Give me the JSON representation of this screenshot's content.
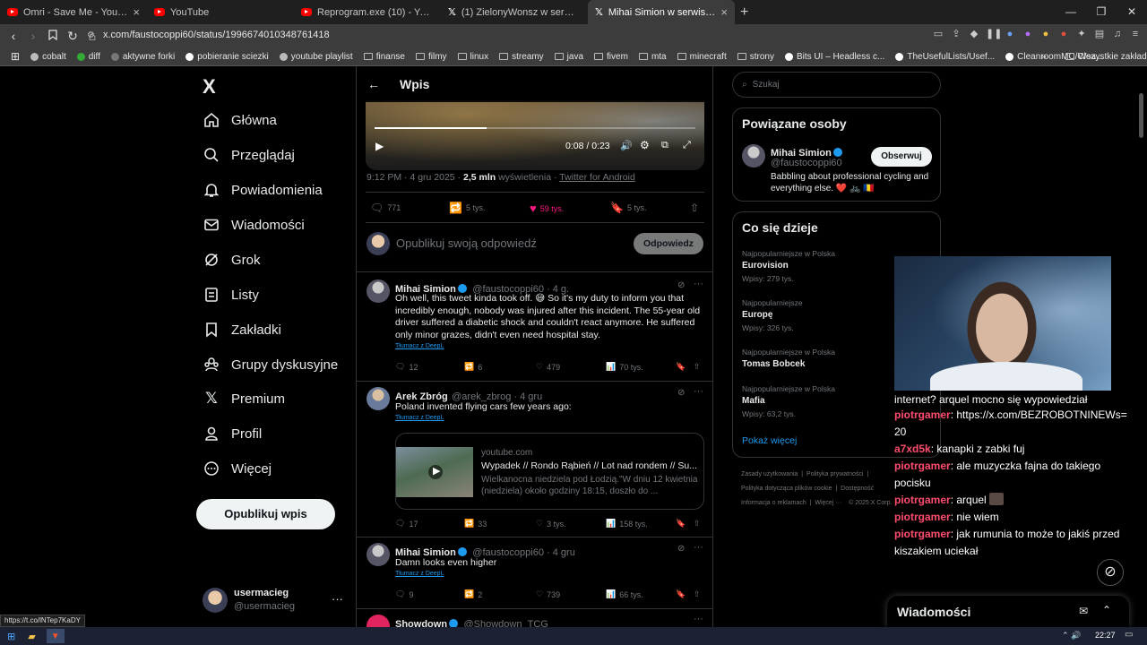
{
  "browser": {
    "tabs": [
      {
        "title": "Omri - Save Me - YouTube",
        "icon": "youtube-icon"
      },
      {
        "title": "YouTube",
        "icon": "youtube-icon"
      },
      {
        "title": "Reprogram.exe (10) - YouTube",
        "icon": "youtube-icon"
      },
      {
        "title": "(1) ZielonyWonsz w serwisie X: „Daw",
        "icon": "x-icon"
      },
      {
        "title": "Mihai Simion w serwisie X: „The",
        "icon": "x-icon",
        "active": true
      }
    ],
    "url": "x.com/faustocoppi60/status/1996674010348761418",
    "bookmarks": [
      "cobalt",
      "diff",
      "aktywne forki",
      "pobieranie sciezki",
      "youtube playlist",
      "finanse",
      "filmy",
      "linux",
      "streamy",
      "java",
      "fivem",
      "mta",
      "minecraft",
      "strony",
      "Bits UI – Headless c...",
      "TheUsefulLists/Usef...",
      "CleanroomMC/Clea..."
    ],
    "bookmarks_other": "Wszystkie zakładki",
    "status_url": "https://t.co/lNTep7KaDY"
  },
  "sidebar": {
    "logo": "X",
    "items": [
      {
        "label": "Główna",
        "icon": "home-icon"
      },
      {
        "label": "Przeglądaj",
        "icon": "search-icon"
      },
      {
        "label": "Powiadomienia",
        "icon": "bell-icon"
      },
      {
        "label": "Wiadomości",
        "icon": "mail-icon"
      },
      {
        "label": "Grok",
        "icon": "grok-icon"
      },
      {
        "label": "Listy",
        "icon": "list-icon"
      },
      {
        "label": "Zakładki",
        "icon": "bookmark-icon"
      },
      {
        "label": "Grupy dyskusyjne",
        "icon": "communities-icon"
      },
      {
        "label": "Premium",
        "icon": "x-premium-icon"
      },
      {
        "label": "Profil",
        "icon": "profile-icon"
      },
      {
        "label": "Więcej",
        "icon": "more-icon"
      }
    ],
    "publish_label": "Opublikuj wpis",
    "user": {
      "name": "usermacieg",
      "handle": "@usermacieg"
    }
  },
  "main": {
    "header_title": "Wpis",
    "video": {
      "time": "0:08 / 0:23",
      "progress": 0.35
    },
    "post_meta": {
      "time": "9:12 PM · 4 gru 2025 ·",
      "views_count": "2,5 mln",
      "views_label": "wyświetlenia ·",
      "source": "Twitter for Android"
    },
    "post_actions": {
      "replies": "771",
      "reposts": "5 tys.",
      "likes": "59 tys.",
      "bookmarks": "5 tys."
    },
    "reply": {
      "placeholder": "Opublikuj swoją odpowiedź",
      "button": "Odpowiedz"
    },
    "replies": [
      {
        "name": "Mihai Simion",
        "handle": "@faustocoppi60 · 4 g.",
        "text": "Oh well, this tweet kinda took off. 😅 So it's my duty to inform you that incredibly enough, nobody was injured after this incident. The 55-year old driver suffered a diabetic shock and couldn't react anymore. He suffered only minor grazes, didn't even need hospital stay.",
        "translate": "Tłumacz z DeepL",
        "stats": {
          "replies": "12",
          "reposts": "6",
          "likes": "479",
          "views": "70 tys."
        }
      },
      {
        "name": "Arek Zbróg",
        "handle": "@arek_zbrog · 4 gru",
        "text": "Poland invented flying cars few years ago:",
        "translate": "Tłumacz z DeepL",
        "card": {
          "domain": "youtube.com",
          "title": "Wypadek // Rondo Rąbień // Lot nad rondem // Su...",
          "desc": "Wielkanocna niedziela pod Łodzią.\"W dniu 12 kwietnia (niedziela) około godziny 18:15, doszło do ..."
        },
        "stats": {
          "replies": "17",
          "reposts": "33",
          "likes": "3 tys.",
          "views": "158 tys."
        }
      },
      {
        "name": "Mihai Simion",
        "handle": "@faustocoppi60 · 4 gru",
        "text": "Damn looks even higher",
        "translate": "Tłumacz z DeepL",
        "stats": {
          "replies": "9",
          "reposts": "2",
          "likes": "739",
          "views": "66 tys."
        }
      },
      {
        "name": "Showdown",
        "handle": "@Showdown_TCG"
      }
    ]
  },
  "right": {
    "search_placeholder": "Szukaj",
    "related_title": "Powiązane osoby",
    "related_person": {
      "name": "Mihai Simion",
      "handle": "@faustocoppi60",
      "bio": "Babbling about professional cycling and everything else. ❤️ 🚲 🇷🇴",
      "follow": "Obserwuj"
    },
    "trends_title": "Co się dzieje",
    "trends": [
      {
        "context": "Najpopularniejsze w Polska",
        "name": "Eurovision",
        "count": "Wpisy: 279 tys."
      },
      {
        "context": "Najpopularniejsze",
        "name": "Europę",
        "count": "Wpisy: 326 tys."
      },
      {
        "context": "Najpopularniejsze w Polska",
        "name": "Tomas Bobcek",
        "count": ""
      },
      {
        "context": "Najpopularniejsze w Polska",
        "name": "Mafia",
        "count": "Wpisy: 63,2 tys."
      }
    ],
    "show_more": "Pokaż więcej",
    "footer": [
      "Zasady użytkowania",
      "Polityka prywatności",
      "Polityka dotycząca plików cookie",
      "Dostępność",
      "Informacja o reklamach",
      "Więcej ···",
      "© 2025 X Corp."
    ]
  },
  "stream_chat": [
    {
      "user": "",
      "text": "internet? arquel mocno się wypowiedział"
    },
    {
      "user": "piotrgamer",
      "text": "https://x.com/BEZROBOTNINEWs=20"
    },
    {
      "user": "a7xd5k",
      "text": "kanapki z zabki fuj"
    },
    {
      "user": "piotrgamer",
      "text": "ale muzyczka fajna do takiego pocisku"
    },
    {
      "user": "piotrgamer",
      "text": "arquel"
    },
    {
      "user": "piotrgamer",
      "text": "nie wiem"
    },
    {
      "user": "piotrgamer",
      "text": "jak rumunia to może to jakiś przed kiszakiem uciekał"
    }
  ],
  "messages_drawer": {
    "label": "Wiadomości"
  },
  "taskbar": {
    "time": "22:27"
  },
  "colors": {
    "like": "#f91880",
    "accent": "#1d9bf0",
    "chat_user": "#ff4d6d"
  }
}
